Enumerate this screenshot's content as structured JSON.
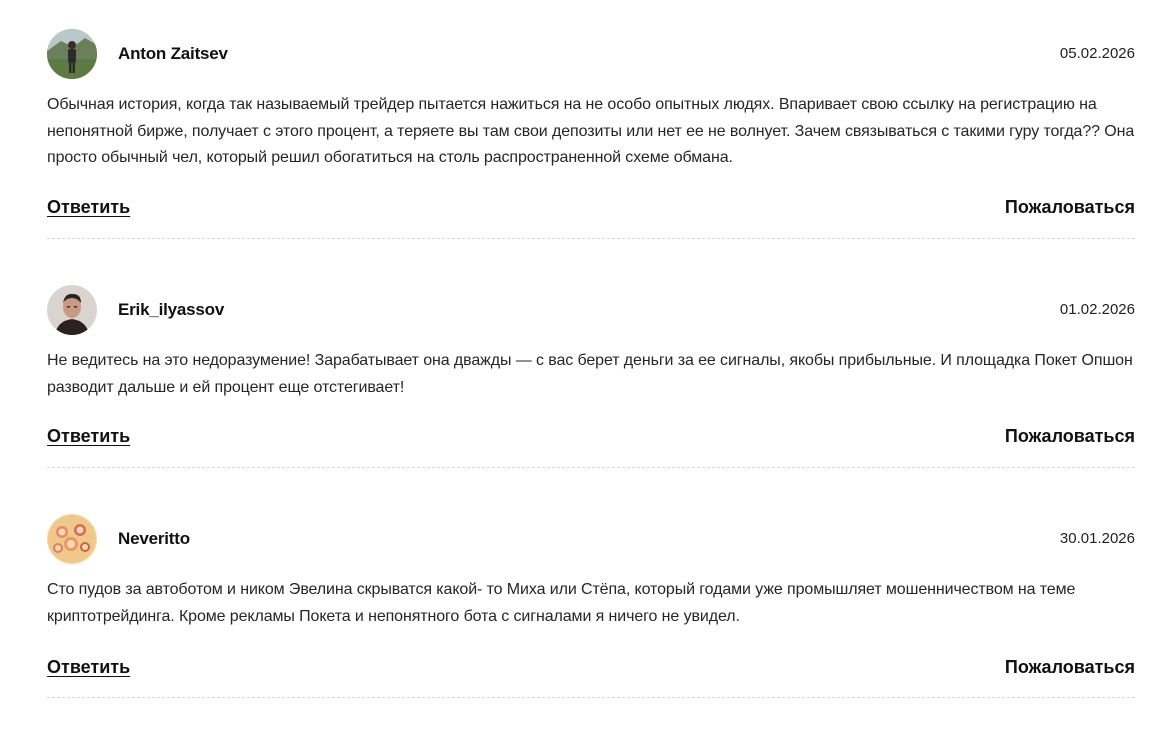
{
  "comments": [
    {
      "author": "Anton Zaitsev",
      "date": "05.02.2026",
      "text": "Обычная история, когда так называемый трейдер пытается нажиться на не особо опытных людях. Впаривает свою ссылку на регистрацию на непонятной бирже, получает с этого процент, а теряете вы там свои депозиты или нет ее не волнует. Зачем связываться с такими гуру тогда?? Она просто обычный чел, который решил обогатиться на столь распространенной схеме обмана.",
      "reply_label": "Ответить",
      "report_label": "Пожаловаться"
    },
    {
      "author": "Erik_ilyassov",
      "date": "01.02.2026",
      "text": "Не ведитесь на это недоразумение! Зарабатывает она дважды — с вас берет деньги за ее сигналы, якобы прибыльные. И площадка Покет Опшон разводит дальше и ей процент еще отстегивает!",
      "reply_label": "Ответить",
      "report_label": "Пожаловаться"
    },
    {
      "author": "Neveritto",
      "date": "30.01.2026",
      "text": "Сто пудов за автоботом и ником Эвелина скрыватся какой- то Миха или Стёпа, который годами уже промышляет мошенничеством на теме криптотрейдинга. Кроме рекламы Покета и непонятного бота с сигналами я ничего не увидел.",
      "reply_label": "Ответить",
      "report_label": "Пожаловаться"
    }
  ]
}
